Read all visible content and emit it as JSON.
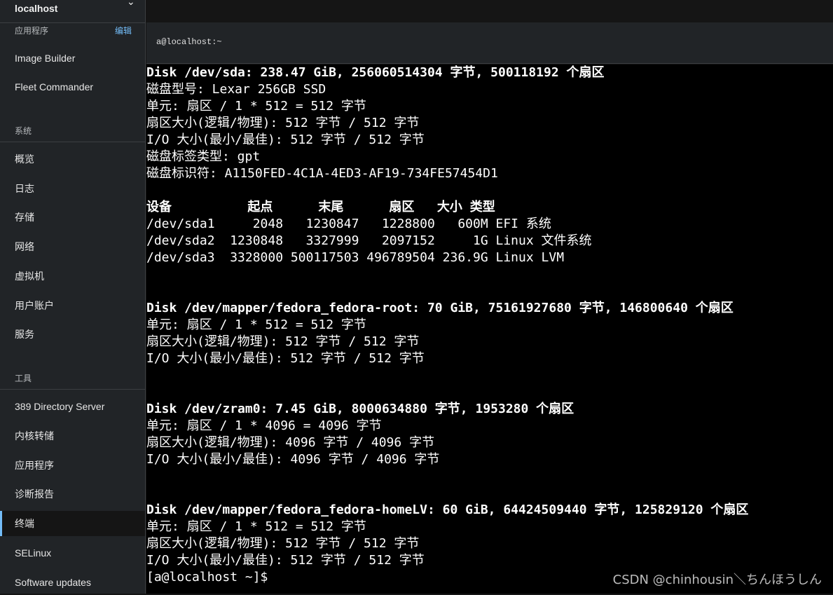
{
  "sidebar": {
    "host": "localhost",
    "apps_label": "应用程序",
    "apps_edit": "编辑",
    "apps": [
      "Image Builder",
      "Fleet Commander"
    ],
    "system_label": "系统",
    "system": [
      "概览",
      "日志",
      "存储",
      "网络",
      "虚拟机",
      "用户账户",
      "服务"
    ],
    "tools_label": "工具",
    "tools": [
      "389 Directory Server",
      "内核转储",
      "应用程序",
      "诊断报告",
      "终端",
      "SELinux",
      "Software updates"
    ],
    "active": "终端"
  },
  "tab": {
    "title": "a@localhost:~"
  },
  "terminal": {
    "lines": [
      {
        "t": "Disk /dev/sda: 238.47 GiB, 256060514304 字节, 500118192 个扇区",
        "b": true
      },
      {
        "t": "磁盘型号: Lexar 256GB SSD",
        "b": false
      },
      {
        "t": "单元: 扇区 / 1 * 512 = 512 字节",
        "b": false
      },
      {
        "t": "扇区大小(逻辑/物理): 512 字节 / 512 字节",
        "b": false
      },
      {
        "t": "I/O 大小(最小/最佳): 512 字节 / 512 字节",
        "b": false
      },
      {
        "t": "磁盘标签类型: gpt",
        "b": false
      },
      {
        "t": "磁盘标识符: A1150FED-4C1A-4ED3-AF19-734FE57454D1",
        "b": false
      },
      {
        "t": "",
        "b": false
      },
      {
        "t": "设备          起点      末尾      扇区   大小 类型",
        "b": true
      },
      {
        "t": "/dev/sda1     2048   1230847   1228800   600M EFI 系统",
        "b": false
      },
      {
        "t": "/dev/sda2  1230848   3327999   2097152     1G Linux 文件系统",
        "b": false
      },
      {
        "t": "/dev/sda3  3328000 500117503 496789504 236.9G Linux LVM",
        "b": false
      },
      {
        "t": "",
        "b": false
      },
      {
        "t": "",
        "b": false
      },
      {
        "t": "Disk /dev/mapper/fedora_fedora-root: 70 GiB, 75161927680 字节, 146800640 个扇区",
        "b": true
      },
      {
        "t": "单元: 扇区 / 1 * 512 = 512 字节",
        "b": false
      },
      {
        "t": "扇区大小(逻辑/物理): 512 字节 / 512 字节",
        "b": false
      },
      {
        "t": "I/O 大小(最小/最佳): 512 字节 / 512 字节",
        "b": false
      },
      {
        "t": "",
        "b": false
      },
      {
        "t": "",
        "b": false
      },
      {
        "t": "Disk /dev/zram0: 7.45 GiB, 8000634880 字节, 1953280 个扇区",
        "b": true
      },
      {
        "t": "单元: 扇区 / 1 * 4096 = 4096 字节",
        "b": false
      },
      {
        "t": "扇区大小(逻辑/物理): 4096 字节 / 4096 字节",
        "b": false
      },
      {
        "t": "I/O 大小(最小/最佳): 4096 字节 / 4096 字节",
        "b": false
      },
      {
        "t": "",
        "b": false
      },
      {
        "t": "",
        "b": false
      },
      {
        "t": "Disk /dev/mapper/fedora_fedora-homeLV: 60 GiB, 64424509440 字节, 125829120 个扇区",
        "b": true
      },
      {
        "t": "单元: 扇区 / 1 * 512 = 512 字节",
        "b": false
      },
      {
        "t": "扇区大小(逻辑/物理): 512 字节 / 512 字节",
        "b": false
      },
      {
        "t": "I/O 大小(最小/最佳): 512 字节 / 512 字节",
        "b": false
      },
      {
        "t": "[a@localhost ~]$",
        "b": false
      }
    ]
  },
  "watermark": "CSDN @chinhousin＼ちんほうしん",
  "colors": {
    "accent": "#73bcf7",
    "sidebar_bg": "#212427",
    "terminal_bg": "#000000"
  }
}
